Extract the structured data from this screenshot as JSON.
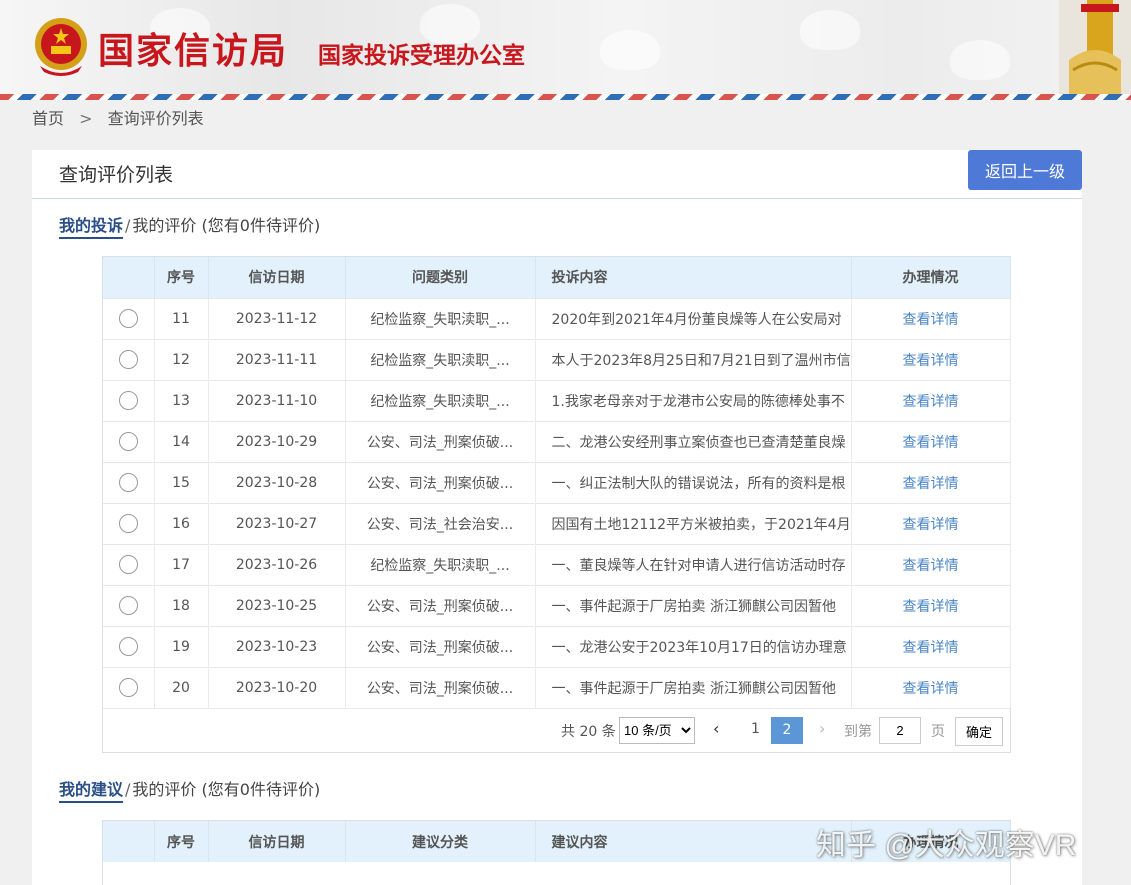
{
  "header": {
    "title": "国家信访局",
    "subtitle": "国家投诉受理办公室"
  },
  "breadcrumb": {
    "home": "首页",
    "separator": ">",
    "current": "查询评价列表"
  },
  "card": {
    "title": "查询评价列表",
    "back_button": "返回上一级"
  },
  "complaints_tabs": {
    "active": "我的投诉",
    "slash": "/",
    "other": "我的评价",
    "pending": "(您有0件待评价)"
  },
  "complaints_table": {
    "headers": [
      "",
      "序号",
      "信访日期",
      "问题类别",
      "投诉内容",
      "办理情况"
    ],
    "rows": [
      {
        "no": "11",
        "date": "2023-11-12",
        "category": "纪检监察_失职渎职_...",
        "content": "2020年到2021年4月份董良燥等人在公安局对",
        "action": "查看详情"
      },
      {
        "no": "12",
        "date": "2023-11-11",
        "category": "纪检监察_失职渎职_...",
        "content": "本人于2023年8月25日和7月21日到了温州市信",
        "action": "查看详情"
      },
      {
        "no": "13",
        "date": "2023-11-10",
        "category": "纪检监察_失职渎职_...",
        "content": "1.我家老母亲对于龙港市公安局的陈德棒处事不",
        "action": "查看详情"
      },
      {
        "no": "14",
        "date": "2023-10-29",
        "category": "公安、司法_刑案侦破...",
        "content": "二、龙港公安经刑事立案侦查也已查清楚董良燥",
        "action": "查看详情"
      },
      {
        "no": "15",
        "date": "2023-10-28",
        "category": "公安、司法_刑案侦破...",
        "content": "一、纠正法制大队的错误说法，所有的资料是根",
        "action": "查看详情"
      },
      {
        "no": "16",
        "date": "2023-10-27",
        "category": "公安、司法_社会治安...",
        "content": "因国有土地12112平方米被拍卖，于2021年4月",
        "action": "查看详情"
      },
      {
        "no": "17",
        "date": "2023-10-26",
        "category": "纪检监察_失职渎职_...",
        "content": "一、董良燥等人在针对申请人进行信访活动时存",
        "action": "查看详情"
      },
      {
        "no": "18",
        "date": "2023-10-25",
        "category": "公安、司法_刑案侦破...",
        "content": "一、事件起源于厂房拍卖 浙江狮麒公司因暂他",
        "action": "查看详情"
      },
      {
        "no": "19",
        "date": "2023-10-23",
        "category": "公安、司法_刑案侦破...",
        "content": "一、龙港公安于2023年10月17日的信访办理意",
        "action": "查看详情"
      },
      {
        "no": "20",
        "date": "2023-10-20",
        "category": "公安、司法_刑案侦破...",
        "content": "一、事件起源于厂房拍卖 浙江狮麒公司因暂他",
        "action": "查看详情"
      }
    ]
  },
  "pagination": {
    "total": "共 20 条",
    "page_size": "10 条/页",
    "prev": "‹",
    "page1": "1",
    "page2": "2",
    "next": "›",
    "goto_label": "到第",
    "goto_value": "2",
    "page_unit": "页",
    "confirm": "确定"
  },
  "suggestions_tabs": {
    "active": "我的建议",
    "slash": "/",
    "other": "我的评价",
    "pending": "(您有0件待评价)"
  },
  "suggestions_table": {
    "headers": [
      "",
      "序号",
      "信访日期",
      "建议分类",
      "建议内容",
      "办理情况"
    ]
  },
  "watermark": "知乎 @大众观察VR",
  "colors": {
    "brand_red": "#c8161d",
    "button_blue": "#4e79d6",
    "link_blue": "#4a86c5",
    "header_bg": "#e2f1fb"
  }
}
